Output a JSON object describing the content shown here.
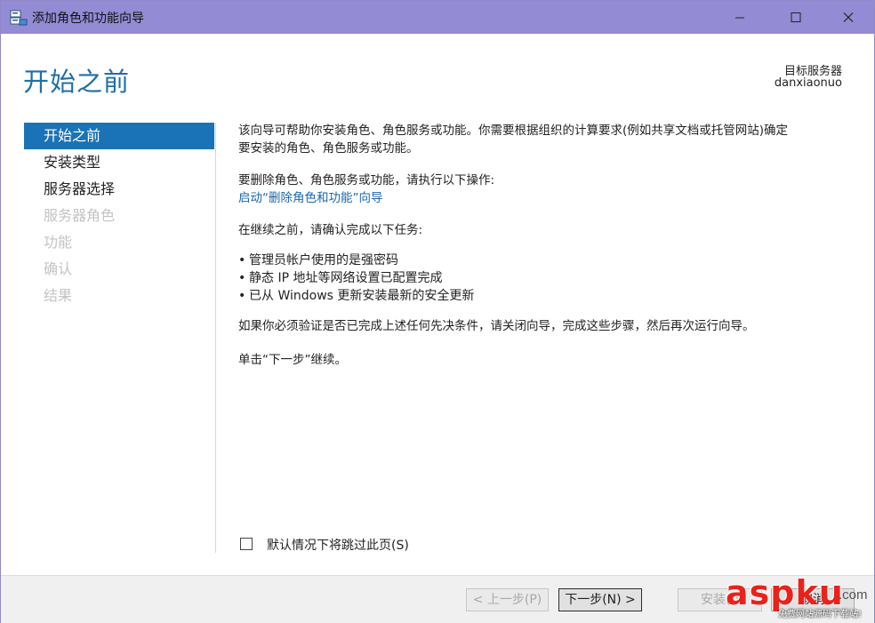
{
  "window": {
    "title": "添加角色和功能向导",
    "icon": "server-wizard-icon"
  },
  "header": {
    "page_title": "开始之前",
    "target_label": "目标服务器",
    "target_value": "danxiaonuo"
  },
  "nav": {
    "items": [
      {
        "label": "开始之前",
        "state": "active"
      },
      {
        "label": "安装类型",
        "state": "enabled"
      },
      {
        "label": "服务器选择",
        "state": "enabled"
      },
      {
        "label": "服务器角色",
        "state": "disabled"
      },
      {
        "label": "功能",
        "state": "disabled"
      },
      {
        "label": "确认",
        "state": "disabled"
      },
      {
        "label": "结果",
        "state": "disabled"
      }
    ]
  },
  "content": {
    "intro_line1": "该向导可帮助你安装角色、角色服务或功能。你需要根据组织的计算要求(例如共享文档或托管网站)确定",
    "intro_line2": "要安装的角色、角色服务或功能。",
    "remove_text": "要删除角色、角色服务或功能，请执行以下操作:",
    "remove_link": "启动“删除角色和功能”向导",
    "confirm_text": "在继续之前，请确认完成以下任务:",
    "tasks": [
      "管理员帐户使用的是强密码",
      "静态 IP 地址等网络设置已配置完成",
      "已从 Windows 更新安装最新的安全更新"
    ],
    "verify_text": "如果你必须验证是否已完成上述任何先决条件，请关闭向导，完成这些步骤，然后再次运行向导。",
    "continue_text": "单击“下一步”继续。"
  },
  "skip": {
    "label": "默认情况下将跳过此页(S)",
    "checked": false
  },
  "footer": {
    "prev_label": "< 上一步(P)",
    "next_label": "下一步(N) >",
    "install_label": "安装(I)",
    "cancel_label": "取消"
  },
  "watermark": {
    "main": "aspku",
    "domain": ".com",
    "sub": "免费网站源码下载站!"
  },
  "colors": {
    "titlebar": "#938bd3",
    "accent": "#1a73b6",
    "title_text": "#1f6fa5",
    "link": "#1a66ad"
  }
}
